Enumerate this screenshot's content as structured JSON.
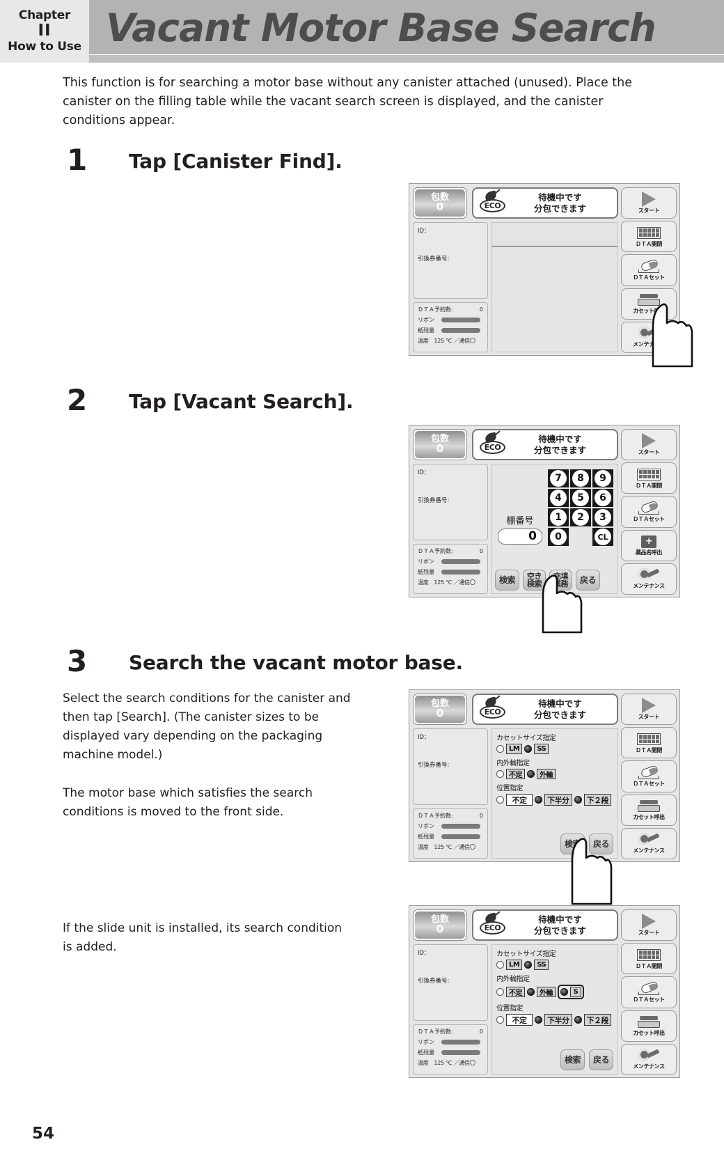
{
  "header": {
    "chapter_word": "Chapter",
    "chapter_number": "II",
    "chapter_sub": "How to Use",
    "title": "Vacant Motor Base Search"
  },
  "intro": "This function is for searching a motor base without any canister attached (unused). Place the canister on the filling table while the vacant search screen is displayed, and the canister conditions appear.",
  "page_number": "54",
  "steps": [
    {
      "number": "1",
      "title": "Tap [Canister Find]."
    },
    {
      "number": "2",
      "title": "Tap [Vacant Search]."
    },
    {
      "number": "3",
      "title": "Search the vacant motor base."
    }
  ],
  "paragraphs": {
    "step3_a": "Select the search conditions for the canister and then tap [Search]. (The canister sizes to be displayed vary depending on the packaging machine model.)",
    "step3_b": "The motor base which satisfies the search conditions is moved to the front side.",
    "step3_c": "If the slide unit is installed, its search condition is added."
  },
  "device": {
    "count_label": "包数",
    "count_value": "0",
    "eco_text": "ECO",
    "status_line1": "待機中です",
    "status_line2": "分包できます",
    "info_id": "ID：",
    "info_ticket": "引換券番号:",
    "stat_dta_label": "ＤＴＡ予約数:",
    "stat_dta_value": "0",
    "stat_ribbon": "リボン",
    "stat_paper": "紙残量",
    "stat_temp": "温度　125 ℃ ／通信〇",
    "sidebar": [
      {
        "label": "スタート",
        "icon": "play-icon"
      },
      {
        "label": "ＤＴＡ開閉",
        "icon": "grid-icon"
      },
      {
        "label": "ＤＴＡセット",
        "icon": "capsule-icon"
      },
      {
        "label": "カセット呼出",
        "icon": "cassette-icon"
      },
      {
        "label": "メンテナンス",
        "icon": "gear-icon"
      }
    ],
    "sidebar_screen2": [
      {
        "label": "スタート",
        "icon": "play-icon"
      },
      {
        "label": "ＤＴＡ開閉",
        "icon": "grid-icon"
      },
      {
        "label": "ＤＴＡセット",
        "icon": "capsule-icon"
      },
      {
        "label": "薬品名呼出",
        "icon": "medicine-icon"
      },
      {
        "label": "メンテナンス",
        "icon": "gear-icon"
      }
    ]
  },
  "keypad_screen": {
    "shelf_label": "棚番号",
    "shelf_value": "0",
    "keys": [
      "7",
      "8",
      "9",
      "4",
      "5",
      "6",
      "1",
      "2",
      "3",
      "0",
      "",
      "CL"
    ],
    "buttons": [
      {
        "label": "検索",
        "name": "search"
      },
      {
        "label": "空き検索",
        "line1": "空き",
        "line2": "検索",
        "name": "vacant-search"
      },
      {
        "label": "充填業務",
        "line1": "充填",
        "line2": "業務",
        "name": "filling-work"
      },
      {
        "label": "戻る",
        "name": "back"
      }
    ]
  },
  "conditions_screen": {
    "size_label": "カセットサイズ指定",
    "size_options": [
      {
        "text": "LM",
        "selected": false
      },
      {
        "text": "SS",
        "selected": true
      }
    ],
    "ring_label": "内外輪指定",
    "ring_options": [
      {
        "text": "不定",
        "selected": false
      },
      {
        "text": "外輪",
        "selected": true
      }
    ],
    "slide_option": {
      "text": "S",
      "selected": true
    },
    "position_label": "位置指定",
    "position_options": [
      {
        "text": "不定",
        "selected": false
      },
      {
        "text": "下半分",
        "selected": true
      },
      {
        "text": "下２段",
        "selected": true
      }
    ],
    "buttons": [
      {
        "label": "検索",
        "name": "search"
      },
      {
        "label": "戻る",
        "name": "back"
      }
    ]
  },
  "colors": {
    "header_band": "#b3b3b3",
    "title_text": "#4d4d4d",
    "body_text": "#231f20",
    "device_bg": "#e6e6e6"
  }
}
